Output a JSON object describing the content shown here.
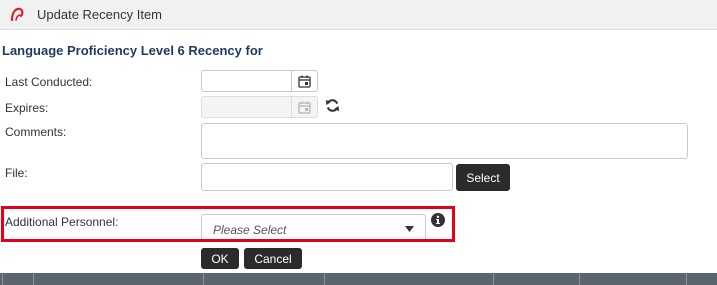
{
  "dialog": {
    "title": "Update Recency Item",
    "heading": "Language Proficiency Level 6 Recency for"
  },
  "form": {
    "last_conducted": {
      "label": "Last Conducted:",
      "value": ""
    },
    "expires": {
      "label": "Expires:",
      "value": ""
    },
    "comments": {
      "label": "Comments:",
      "value": ""
    },
    "file": {
      "label": "File:",
      "value": "",
      "select_label": "Select"
    },
    "additional_personnel": {
      "label": "Additional Personnel:",
      "placeholder": "Please Select"
    }
  },
  "actions": {
    "ok_label": "OK",
    "cancel_label": "Cancel"
  },
  "colors": {
    "accent_red": "#e3001b",
    "heading_blue": "#1f3a5f",
    "button_dark": "#2b2b2b"
  },
  "icons": [
    "app-logo-icon",
    "calendar-icon",
    "refresh-icon",
    "info-icon",
    "chevron-down-icon"
  ]
}
